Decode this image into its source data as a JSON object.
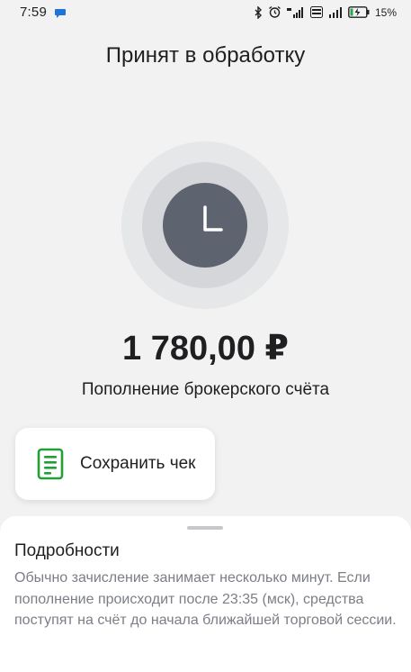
{
  "status_bar": {
    "time": "7:59",
    "battery": "15%",
    "icons": [
      "message-bubble-icon",
      "bluetooth-icon",
      "alarm-icon",
      "signal-icon",
      "volte-icon",
      "signal-icon",
      "battery-charging-icon"
    ]
  },
  "header": {
    "title": "Принят в обработку"
  },
  "status_icon": {
    "name": "clock-icon",
    "colors": {
      "outer": "#e6e7e9",
      "middle": "#d4d6d9",
      "inner": "#5d6470"
    }
  },
  "transaction": {
    "amount": "1 780,00 ₽",
    "description": "Пополнение брокерского счёта"
  },
  "actions": {
    "save_receipt_label": "Сохранить чек",
    "save_receipt_icon": "document-icon",
    "accent": "#21a038"
  },
  "details": {
    "title": "Подробности",
    "text": "Обычно зачисление занимает несколько минут. Если пополнение происходит после 23:35 (мск), средства поступят на счёт до начала ближайшей торговой сессии."
  }
}
